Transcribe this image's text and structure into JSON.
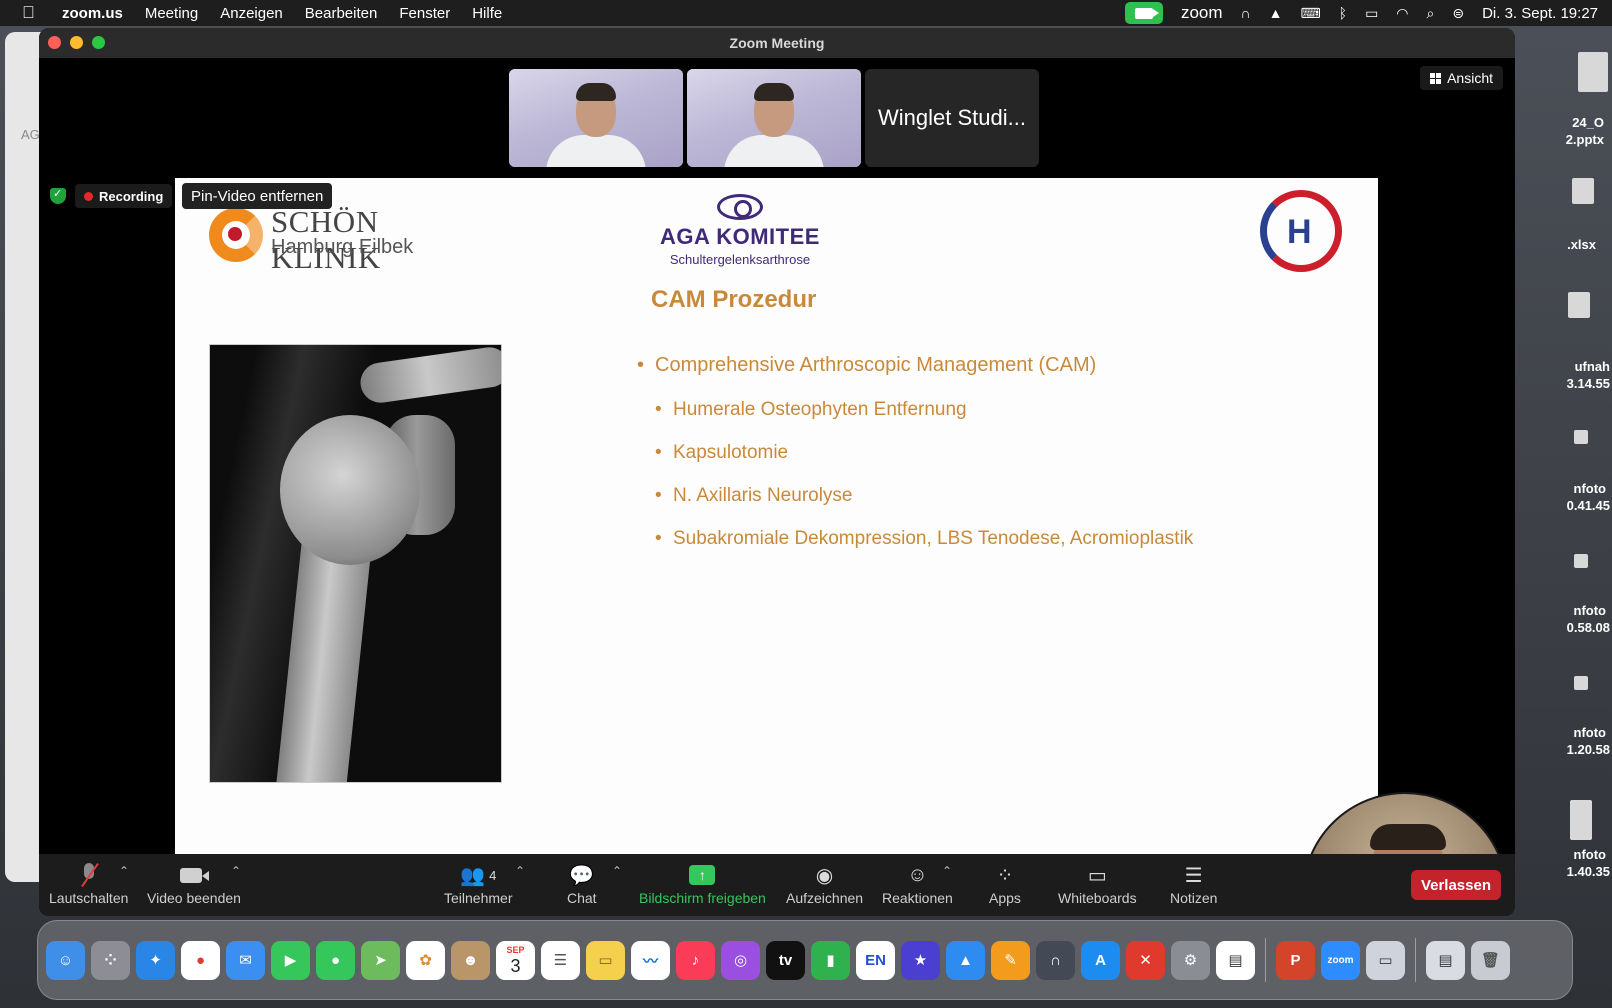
{
  "menubar": {
    "app": "zoom.us",
    "items": [
      "Meeting",
      "Anzeigen",
      "Bearbeiten",
      "Fenster",
      "Hilfe"
    ],
    "zoom_brand": "zoom",
    "datetime": "Di. 3. Sept.  19:27"
  },
  "desktop": {
    "background_window_tag": "AG",
    "files": [
      "24_O",
      "2.pptx",
      ".xlsx",
      "ufnah",
      "3.14.55",
      "nfoto",
      "0.41.45",
      "nfoto",
      "0.58.08",
      "nfoto",
      "1.20.58",
      "nfoto",
      "1.40.35"
    ]
  },
  "window": {
    "title": "Zoom Meeting",
    "view_button": "Ansicht",
    "participant_name_tile": "Winglet Studi...",
    "recording_label": "Recording",
    "pin_label": "Pin-Video entfernen"
  },
  "slide": {
    "clinic_name": "SCHÖN KLINIK",
    "clinic_location": "Hamburg Eilbek",
    "committee_name": "AGA KOMITEE",
    "committee_sub": "Schultergelenksarthrose",
    "title": "CAM Prozedur",
    "bullet_main": "Comprehensive Arthroscopic Management (CAM)",
    "sub_bullets": [
      "Humerale Osteophyten Entfernung",
      "Kapsulotomie",
      "N. Axillaris Neurolyse",
      "Subakromiale Dekompression, LBS Tenodese, Acromioplastik"
    ]
  },
  "toolbar": {
    "mute": "Lautschalten",
    "video": "Video beenden",
    "participants": "Teilnehmer",
    "participants_count": "4",
    "chat": "Chat",
    "share": "Bildschirm freigeben",
    "record": "Aufzeichnen",
    "reactions": "Reaktionen",
    "apps": "Apps",
    "whiteboards": "Whiteboards",
    "notes": "Notizen",
    "leave": "Verlassen"
  },
  "dock": {
    "calendar_month": "SEP",
    "calendar_day": "3",
    "lang_app": "EN",
    "tv_app": "tv",
    "zoom_app": "zoom"
  },
  "colors": {
    "accent_green": "#35c65c",
    "leave_red": "#c4232c",
    "slide_gold": "#c9893a",
    "aga_purple": "#3f2a7a"
  }
}
